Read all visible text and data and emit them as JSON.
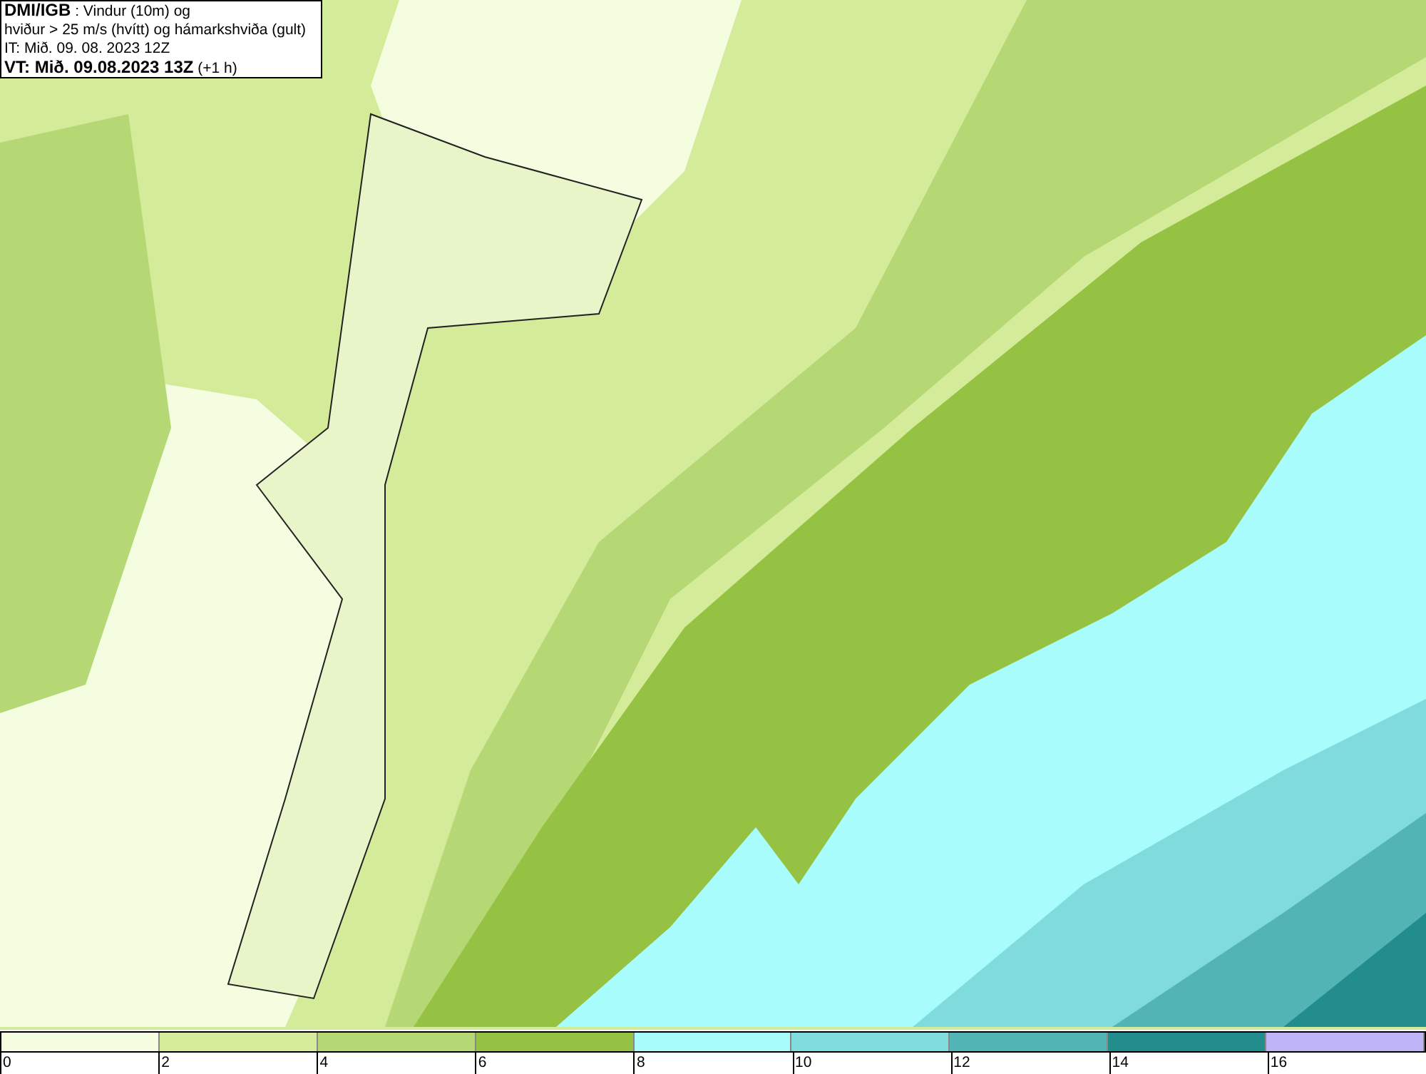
{
  "header": {
    "lines": [
      "**DMI/IGB** : Vindur (10m) og",
      "hviður > 25 m/s (hvítt) og hámarkshviða (gult)",
      "IT: Mið. 09. 08. 2023 12Z",
      "**VT: Mið. 09.08.2023 13Z** (+1 h)"
    ]
  },
  "legend": {
    "bins": [
      {
        "label": "0",
        "color": "#f5fde0"
      },
      {
        "label": "2",
        "color": "#d4ec9a"
      },
      {
        "label": "4",
        "color": "#b5d774"
      },
      {
        "label": "6",
        "color": "#96c244"
      },
      {
        "label": "8",
        "color": "#a8fcfc"
      },
      {
        "label": "10",
        "color": "#80dcdc"
      },
      {
        "label": "12",
        "color": "#52b4b4"
      },
      {
        "label": "14",
        "color": "#238c8c"
      },
      {
        "label": "16",
        "color": "#c0b4f8"
      }
    ]
  }
}
